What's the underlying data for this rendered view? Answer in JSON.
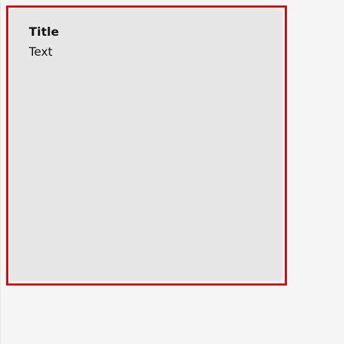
{
  "card": {
    "title": "Title",
    "text": "Text"
  },
  "colors": {
    "page_background": "#f5f5f5",
    "card_background": "#e7e7e7",
    "highlight_border": "#e00000",
    "text": "#111111"
  }
}
